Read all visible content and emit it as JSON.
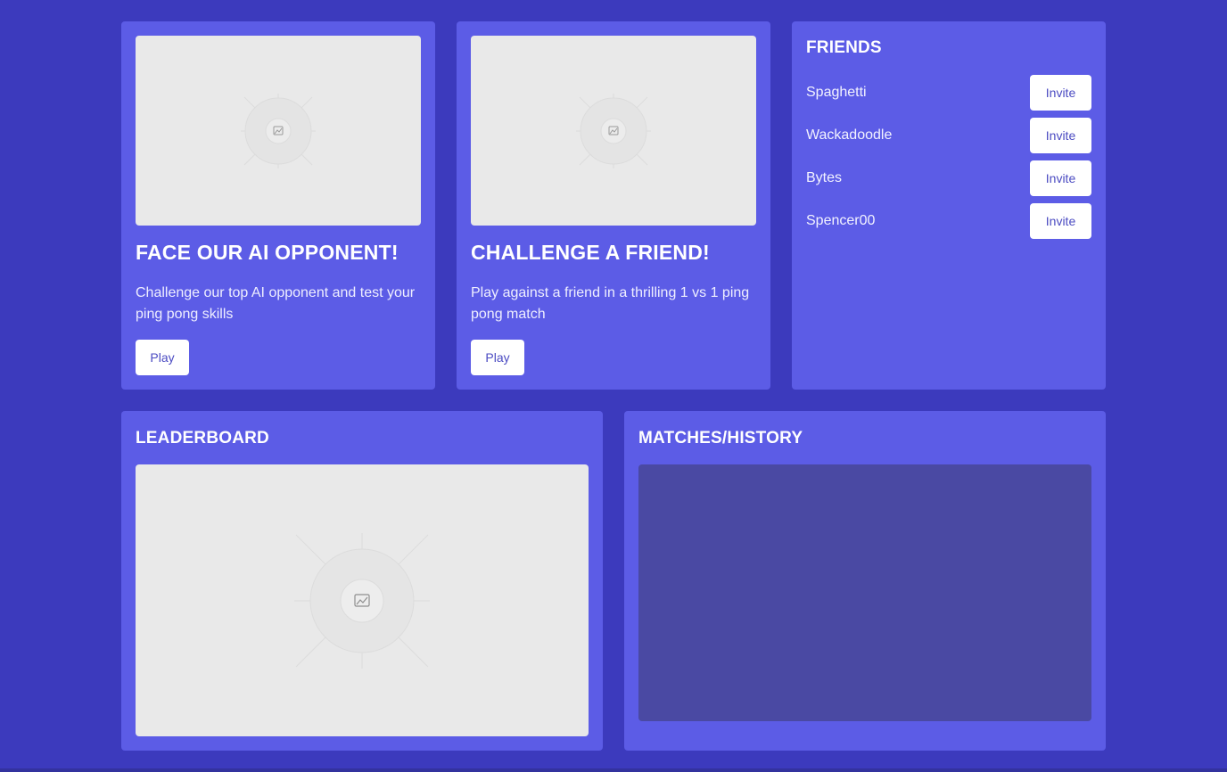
{
  "ai_card": {
    "title": "FACE OUR AI OPPONENT!",
    "description": "Challenge our top AI opponent and test your ping pong skills",
    "play_label": "Play",
    "image_icon": "image-icon"
  },
  "friend_card": {
    "title": "CHALLENGE A FRIEND!",
    "description": "Play against a friend in a thrilling 1 vs 1 ping pong match",
    "play_label": "Play",
    "image_icon": "image-icon"
  },
  "friends": {
    "title": "FRIENDS",
    "items": [
      {
        "name": "Spaghetti",
        "action": "Invite"
      },
      {
        "name": "Wackadoodle",
        "action": "Invite"
      },
      {
        "name": "Bytes",
        "action": "Invite"
      },
      {
        "name": "Spencer00",
        "action": "Invite"
      }
    ]
  },
  "leaderboard": {
    "title": "LEADERBOARD",
    "image_icon": "image-icon"
  },
  "history": {
    "title": "MATCHES/HISTORY"
  },
  "colors": {
    "background": "#3c3abd",
    "card": "#5c5ce6",
    "placeholder": "#e9e9e9",
    "history_panel": "#4a49a3",
    "button_text": "#4b4bc2"
  }
}
